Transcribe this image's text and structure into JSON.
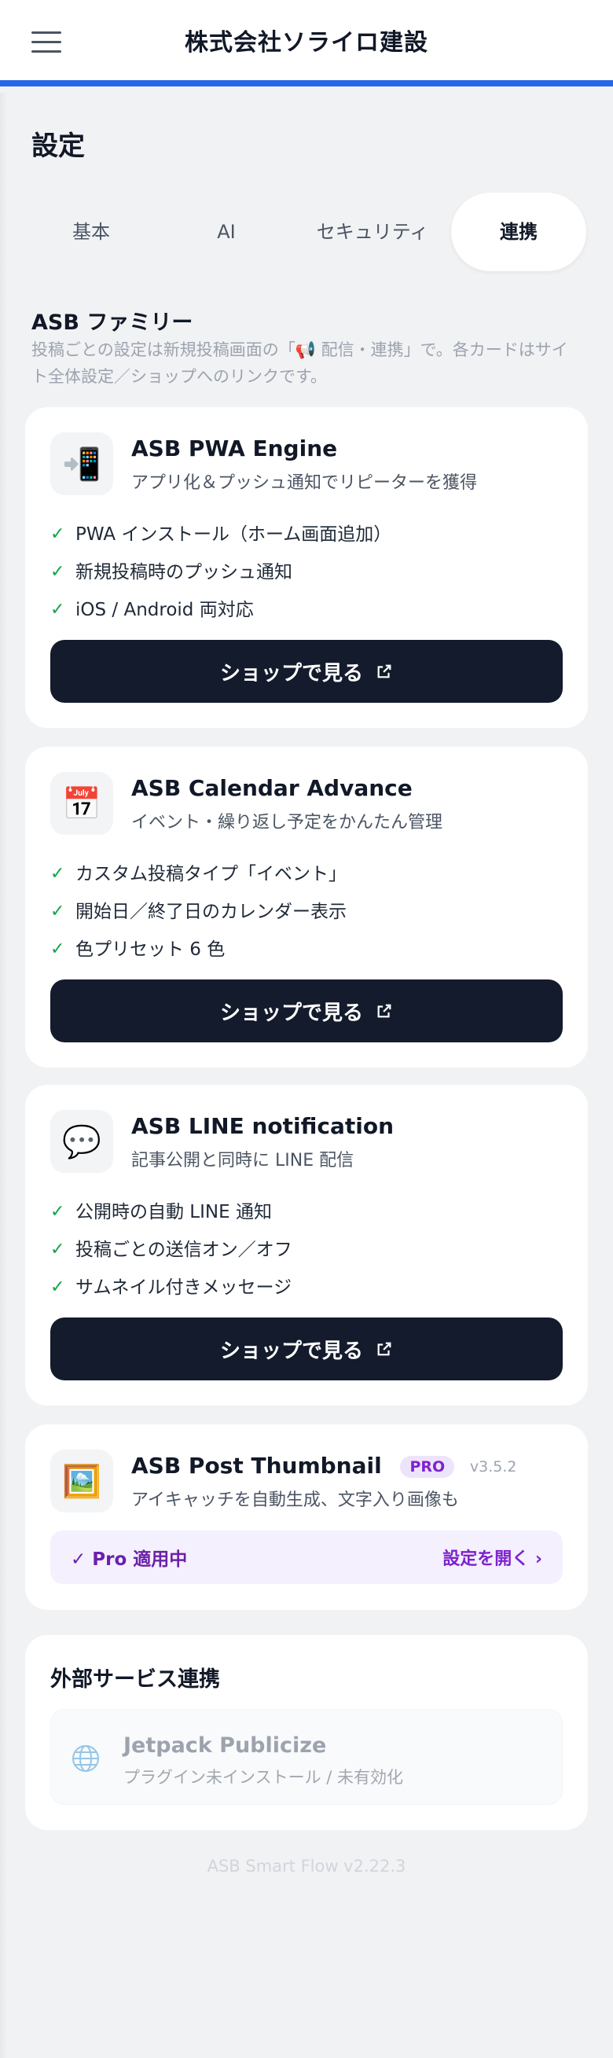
{
  "header": {
    "title": "株式会社ソライロ建設"
  },
  "page_title": "設定",
  "tabs": [
    {
      "label": "基本"
    },
    {
      "label": "AI"
    },
    {
      "label": "セキュリティ"
    },
    {
      "label": "連携",
      "active": true
    }
  ],
  "section": {
    "title": "ASB ファミリー",
    "description": "投稿ごとの設定は新規投稿画面の「📢 配信・連携」で。各カードはサイト全体設定／ショップへのリンクです。"
  },
  "products": [
    {
      "icon": "📲",
      "title": "ASB PWA Engine",
      "subtitle": "アプリ化＆プッシュ通知でリピーターを獲得",
      "features": [
        "PWA インストール（ホーム画面追加）",
        "新規投稿時のプッシュ通知",
        "iOS / Android 両対応"
      ],
      "button": "ショップで見る"
    },
    {
      "icon": "📅",
      "title": "ASB Calendar Advance",
      "subtitle": "イベント・繰り返し予定をかんたん管理",
      "features": [
        "カスタム投稿タイプ「イベント」",
        "開始日／終了日のカレンダー表示",
        "色プリセット 6 色"
      ],
      "button": "ショップで見る"
    },
    {
      "icon": "💬",
      "title": "ASB LINE notification",
      "subtitle": "記事公開と同時に LINE 配信",
      "features": [
        "公開時の自動 LINE 通知",
        "投稿ごとの送信オン／オフ",
        "サムネイル付きメッセージ"
      ],
      "button": "ショップで見る"
    }
  ],
  "pro_product": {
    "icon": "🖼️",
    "title": "ASB Post Thumbnail",
    "badge": "PRO",
    "version": "v3.5.2",
    "subtitle": "アイキャッチを自動生成、文字入り画像も",
    "status": "✓ Pro 適用中",
    "link": "設定を開く ›"
  },
  "external": {
    "title": "外部サービス連携",
    "services": [
      {
        "name": "Jetpack Publicize",
        "status": "プラグイン未インストール / 未有効化"
      }
    ]
  },
  "footer": "ASB Smart Flow v2.22.3",
  "colors": {
    "accent": "#2667e8",
    "button": "#131b2c",
    "check": "#16a34a",
    "pro": "#7e22ce"
  }
}
